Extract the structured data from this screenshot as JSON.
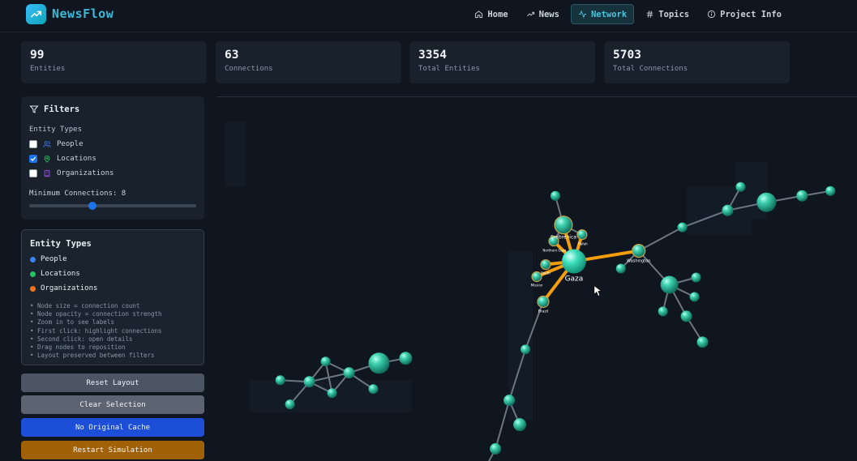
{
  "app": {
    "title": "NewsFlow",
    "logo_icon": "trending-up-icon"
  },
  "nav": [
    {
      "label": "Home",
      "icon": "home-icon",
      "active": false
    },
    {
      "label": "News",
      "icon": "trending-icon",
      "active": false
    },
    {
      "label": "Network",
      "icon": "activity-icon",
      "active": true
    },
    {
      "label": "Topics",
      "icon": "hash-icon",
      "active": false
    },
    {
      "label": "Project Info",
      "icon": "info-icon",
      "active": false
    }
  ],
  "stats": [
    {
      "value": "99",
      "label": "Entities"
    },
    {
      "value": "63",
      "label": "Connections"
    },
    {
      "value": "3354",
      "label": "Total Entities"
    },
    {
      "value": "5703",
      "label": "Total Connections"
    }
  ],
  "filters": {
    "title": "Filters",
    "entity_types_label": "Entity Types",
    "options": [
      {
        "label": "People",
        "checked": false,
        "icon": "users-icon",
        "color": "#3b82f6"
      },
      {
        "label": "Locations",
        "checked": true,
        "icon": "map-pin-icon",
        "color": "#22c55e"
      },
      {
        "label": "Organizations",
        "checked": false,
        "icon": "building-icon",
        "color": "#a855f7"
      }
    ],
    "min_connections_label": "Minimum Connections: 8",
    "min_connections_value": 8,
    "min_connections_fraction": 0.38
  },
  "legend": {
    "title": "Entity Types",
    "items": [
      {
        "label": "People",
        "color": "#3b82f6"
      },
      {
        "label": "Locations",
        "color": "#22c55e"
      },
      {
        "label": "Organizations",
        "color": "#f97316"
      }
    ],
    "notes": [
      "• Node size = connection count",
      "• Node opacity = connection strength",
      "• Zoom in to see labels",
      "• First click: highlight connections",
      "• Second click: open details",
      "• Drag nodes to reposition",
      "• Layout preserved between filters"
    ]
  },
  "buttons": [
    {
      "label": "Reset Layout",
      "color": "#4b5563"
    },
    {
      "label": "Clear Selection",
      "color": "#5b6470"
    },
    {
      "label": "No Original Cache",
      "color": "#1d4ed8"
    },
    {
      "label": "Restart Simulation",
      "color": "#a16207"
    }
  ],
  "graph": {
    "node_color": "#1fa58a",
    "highlight_edge_color": "#f59e0b",
    "labels": {
      "gaza": "Gaza",
      "srebrenica": "Srebrenica",
      "northern_gaza": "Northern Gaza",
      "rafah": "Rafah",
      "washington": "Washington",
      "brazil": "Brazil",
      "south": "South",
      "mission": "Mission"
    }
  }
}
